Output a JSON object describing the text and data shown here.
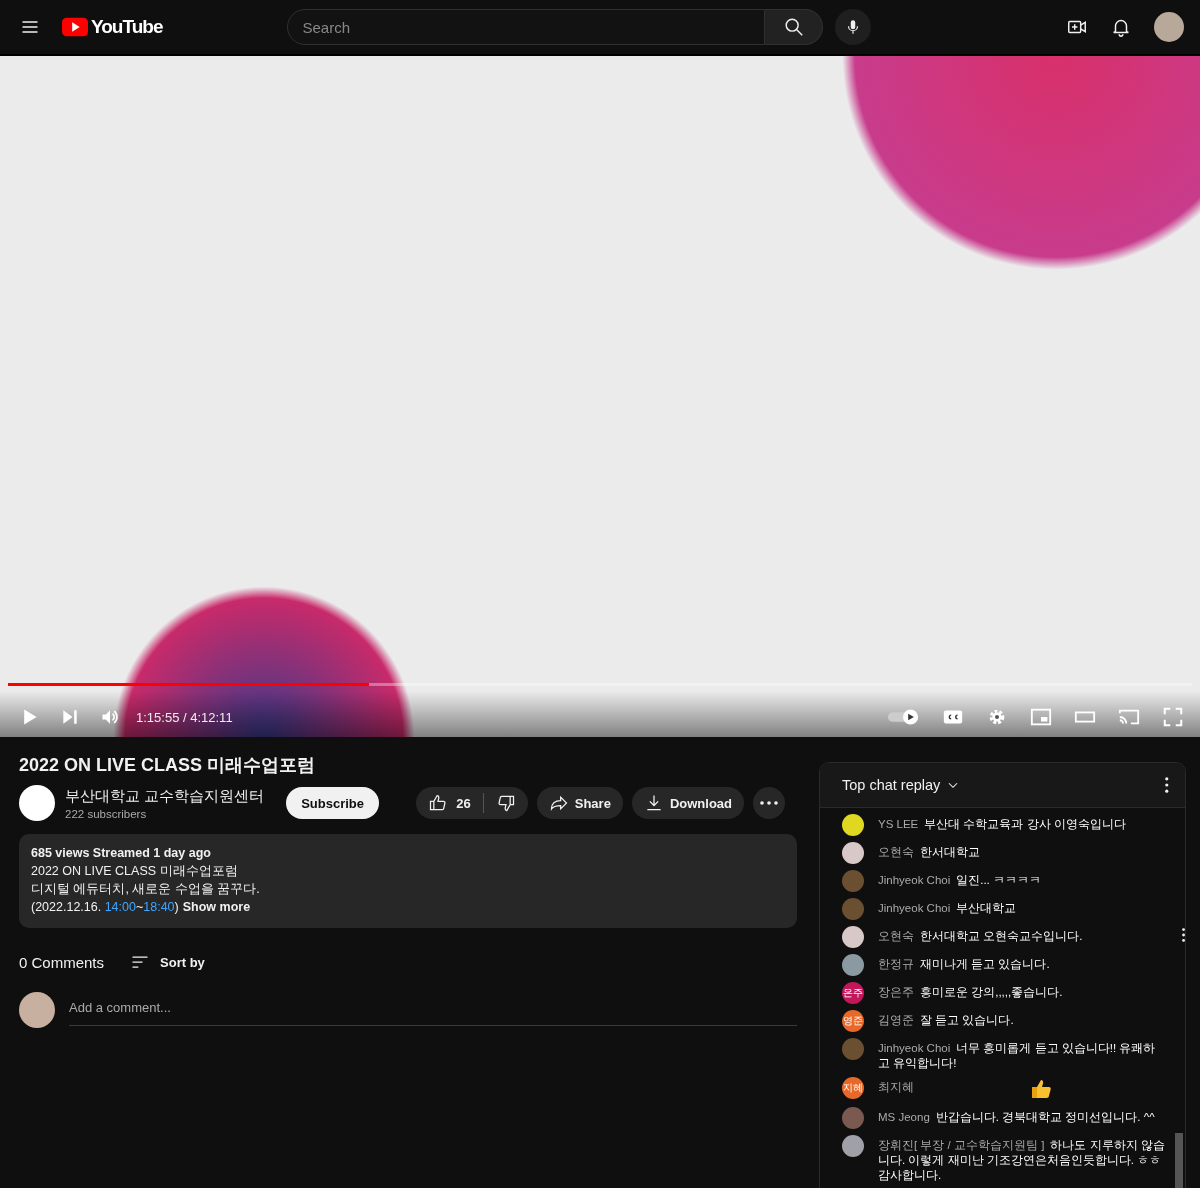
{
  "header": {
    "logo": "YouTube",
    "search": {
      "placeholder": "Search"
    }
  },
  "player": {
    "progress": {
      "level": 0.305
    },
    "time": "1:15:55 / 4:12:11",
    "autoplay": {
      "on": true
    }
  },
  "video": {
    "title": "2022 ON LIVE CLASS 미래수업포럼",
    "channel": {
      "name": "부산대학교 교수학습지원센터",
      "subscribers": "222 subscribers"
    },
    "subscribe": "Subscribe",
    "likes": "26",
    "share": "Share",
    "download": "Download"
  },
  "description": {
    "stats": "685 views  Streamed 1 day ago",
    "lines": [
      "2022 ON LIVE CLASS 미래수업포럼",
      "디지털 에듀터치, 새로운 수업을 꿈꾸다."
    ],
    "last_line": [
      {
        "kind": "text",
        "text": "(2022.12.16. "
      },
      {
        "kind": "link",
        "text": "14:00"
      },
      {
        "kind": "text",
        "text": "~"
      },
      {
        "kind": "link",
        "text": "18:40"
      },
      {
        "kind": "text",
        "text": ")"
      }
    ],
    "show_more": "Show more"
  },
  "comments": {
    "count": "0 Comments",
    "sort": "Sort by",
    "placeholder": "Add a comment..."
  },
  "chat": {
    "title": "Top chat replay",
    "messages": [
      {
        "author": "YS LEE",
        "avatar": {
          "kind": "photo",
          "color": "#e0d820"
        },
        "kind": "text",
        "text": "부산대 수학교육과 강사 이영숙입니다",
        "hovered": false
      },
      {
        "author": "오현숙",
        "avatar": {
          "kind": "photo",
          "color": "#d8c8c8"
        },
        "kind": "text",
        "text": "한서대학교",
        "hovered": false
      },
      {
        "author": "Jinhyeok Choi",
        "avatar": {
          "kind": "photo",
          "color": "#6a5030"
        },
        "kind": "text",
        "text": "일진... ㅋㅋㅋㅋ",
        "hovered": false
      },
      {
        "author": "Jinhyeok Choi",
        "avatar": {
          "kind": "photo",
          "color": "#6a5030"
        },
        "kind": "text",
        "text": "부산대학교",
        "hovered": false
      },
      {
        "author": "오현숙",
        "avatar": {
          "kind": "photo",
          "color": "#d8c8c8"
        },
        "kind": "text",
        "text": "한서대학교 오현숙교수입니다.",
        "hovered": true
      },
      {
        "author": "한정규",
        "avatar": {
          "kind": "photo",
          "color": "#8a9aa0"
        },
        "kind": "text",
        "text": "재미나게 듣고 있습니다.",
        "hovered": false
      },
      {
        "author": "장은주",
        "avatar": {
          "kind": "initials",
          "initials": "은주",
          "color": "#c2185b"
        },
        "kind": "text",
        "text": "흥미로운 강의,,,,,좋습니다.",
        "hovered": false
      },
      {
        "author": "김영준",
        "avatar": {
          "kind": "initials",
          "initials": "영준",
          "color": "#e8682a"
        },
        "kind": "text",
        "text": "잘 듣고 있습니다.",
        "hovered": false
      },
      {
        "author": "Jinhyeok Choi",
        "avatar": {
          "kind": "photo",
          "color": "#6a5030"
        },
        "kind": "text",
        "text": "너무 흥미롭게 듣고 있습니다!! 유쾌하고 유익합니다!",
        "hovered": false
      },
      {
        "author": "최지혜",
        "avatar": {
          "kind": "initials",
          "initials": "지혜",
          "color": "#e8682a"
        },
        "kind": "thumbs",
        "hovered": false
      },
      {
        "author": "MS Jeong",
        "avatar": {
          "kind": "photo",
          "color": "#7a5a50"
        },
        "kind": "text",
        "text": "반갑습니다. 경북대학교 정미선입니다. ^^",
        "hovered": false
      },
      {
        "author": "장휘진[ 부장 / 교수학습지원팀 ]",
        "avatar": {
          "kind": "photo",
          "color": "#a0a0a8"
        },
        "kind": "text",
        "text": "하나도 지루하지 않습니다. 이렇게 재미난 기조강연은처음인듯합니다. ㅎㅎ 감사합니다.",
        "hovered": false
      }
    ]
  }
}
